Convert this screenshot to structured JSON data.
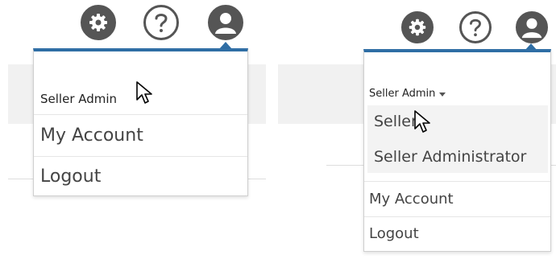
{
  "icons": {
    "settings": "gear-icon",
    "help": "question-mark-icon",
    "user": "user-avatar-icon"
  },
  "colors": {
    "accent": "#2f6ea5",
    "icon": "#555555"
  },
  "left": {
    "dropdown": {
      "header_label": "Seller Admin",
      "items": [
        {
          "label": "My Account"
        },
        {
          "label": "Logout"
        }
      ]
    }
  },
  "right": {
    "dropdown": {
      "header_label": "Seller Admin",
      "sub_items": [
        {
          "label": "Seller"
        },
        {
          "label": "Seller Administrator"
        }
      ],
      "items": [
        {
          "label": "My Account"
        },
        {
          "label": "Logout"
        }
      ]
    }
  }
}
